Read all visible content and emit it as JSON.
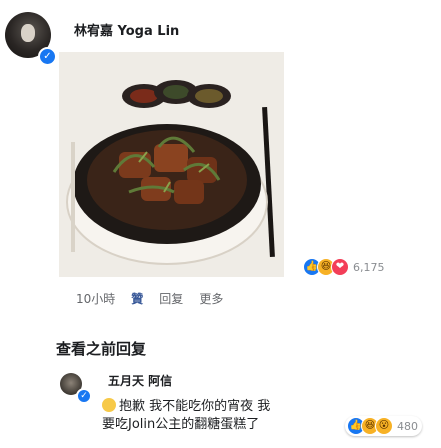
{
  "post": {
    "author": "林宥嘉 Yoga Lin",
    "reaction_count": "6,175",
    "reactions": [
      "like",
      "haha",
      "love"
    ],
    "actions": {
      "time": "10小時",
      "like": "贊",
      "reply": "回复",
      "more": "更多"
    }
  },
  "view_previous_replies": "查看之前回复",
  "comment": {
    "author": "五月天 阿信",
    "text_line1": "抱歉 我不能吃你的宵夜 我",
    "text_line2": "要吃Jolin公主的翻糖蛋糕了",
    "reaction_count": "480",
    "reactions": [
      "like",
      "haha",
      "wow"
    ]
  },
  "colors": {
    "link_blue": "#385898",
    "like_blue": "#1877f2",
    "love_red": "#f33e58",
    "haha_yellow": "#f7b125"
  }
}
